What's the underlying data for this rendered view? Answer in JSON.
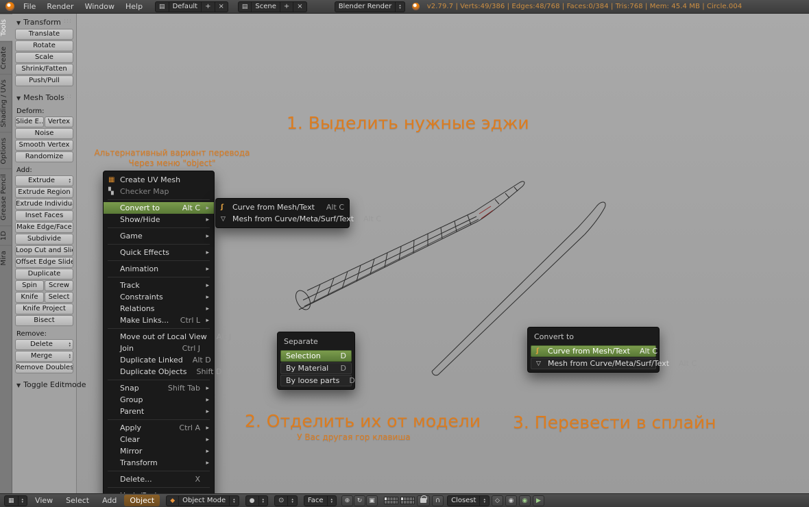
{
  "colors": {
    "annotation_orange": "#dd7c1e",
    "menu_highlight_green": "#5a7a37",
    "stats_text": "#cd8f42",
    "viewport_gray": "#9f9f9f"
  },
  "top_header": {
    "menus": [
      "File",
      "Render",
      "Window",
      "Help"
    ],
    "layout_value": "Default",
    "scene_value": "Scene",
    "engine_value": "Blender Render",
    "stats": "v2.79.7 | Verts:49/386 | Edges:48/768 | Faces:0/384 | Tris:768 | Mem: 45.4 MB | Circle.004"
  },
  "tool_tabs": {
    "tabs": [
      "Tools",
      "Create",
      "Shading / UVs",
      "Options",
      "Grease Pencil",
      "1D",
      "Mira"
    ]
  },
  "tool_shelf": {
    "panels": {
      "transform_title": "Transform",
      "mesh_tools_title": "Mesh Tools",
      "toggle_editmode_title": "Toggle Editmode"
    },
    "transform_buttons": [
      "Translate",
      "Rotate",
      "Scale",
      "Shrink/Fatten",
      "Push/Pull"
    ],
    "deform_label": "Deform:",
    "slide_button": "Slide E...",
    "vertex_button": "Vertex",
    "deform_buttons": [
      "Noise",
      "Smooth Vertex",
      "Randomize"
    ],
    "add_label": "Add:",
    "extrude_dropdown": "Extrude",
    "add_buttons": [
      "Extrude Region",
      "Extrude Individual",
      "Inset Faces",
      "Make Edge/Face",
      "Subdivide",
      "Loop Cut and Slide",
      "Offset Edge Slide",
      "Duplicate"
    ],
    "spin_button": "Spin",
    "screw_button": "Screw",
    "knife_button": "Knife",
    "select_button": "Select",
    "knife_project_button": "Knife Project",
    "bisect_button": "Bisect",
    "remove_label": "Remove:",
    "delete_dropdown": "Delete",
    "merge_dropdown": "Merge",
    "remove_doubles_button": "Remove Doubles"
  },
  "object_menu": {
    "items": [
      {
        "label": "Create UV Mesh"
      },
      {
        "label": "Checker Map"
      },
      {
        "label": "Convert to",
        "shortcut": "Alt C"
      },
      {
        "label": "Show/Hide"
      },
      {
        "label": "Game"
      },
      {
        "label": "Quick Effects"
      },
      {
        "label": "Animation"
      },
      {
        "label": "Track"
      },
      {
        "label": "Constraints"
      },
      {
        "label": "Relations"
      },
      {
        "label": "Make Links...",
        "shortcut": "Ctrl L"
      },
      {
        "label": "Move out of Local View",
        "shortcut": "Alt J"
      },
      {
        "label": "Join",
        "shortcut": "Ctrl J"
      },
      {
        "label": "Duplicate Linked",
        "shortcut": "Alt D"
      },
      {
        "label": "Duplicate Objects",
        "shortcut": "Shift D"
      },
      {
        "label": "Snap",
        "shortcut": "Shift Tab"
      },
      {
        "label": "Group"
      },
      {
        "label": "Parent"
      },
      {
        "label": "Apply",
        "shortcut": "Ctrl A"
      },
      {
        "label": "Clear"
      },
      {
        "label": "Mirror"
      },
      {
        "label": "Transform"
      },
      {
        "label": "Delete...",
        "shortcut": "X"
      },
      {
        "label": "Undo/Redo"
      }
    ]
  },
  "convert_submenu": {
    "items": [
      {
        "label": "Curve from Mesh/Text",
        "shortcut": "Alt C"
      },
      {
        "label": "Mesh from Curve/Meta/Surf/Text",
        "shortcut": "Alt C"
      }
    ]
  },
  "separate_popup": {
    "title": "Separate",
    "items": [
      {
        "label": "Selection",
        "shortcut": "D"
      },
      {
        "label": "By Material",
        "shortcut": "D"
      },
      {
        "label": "By loose parts",
        "shortcut": "D"
      }
    ]
  },
  "convert_popup": {
    "title": "Convert to",
    "items": [
      {
        "label": "Curve from Mesh/Text",
        "shortcut": "Alt C"
      },
      {
        "label": "Mesh from Curve/Meta/Surf/Text",
        "shortcut": "Alt C"
      }
    ]
  },
  "annotations": {
    "step1": "1. Выделить нужные эджи",
    "alt_line1": "Альтернативный вариант перевода",
    "alt_line2": "Через меню \"object\"",
    "step2": "2. Отделить их от модели",
    "step2_sub": "У Вас другая гор клавиша",
    "step3": "3. Перевести в сплайн"
  },
  "bottom_header": {
    "menus": [
      "View",
      "Select",
      "Add",
      "Object"
    ],
    "mode_value": "Object Mode",
    "face_value": "Face",
    "snap_target_value": "Closest"
  }
}
